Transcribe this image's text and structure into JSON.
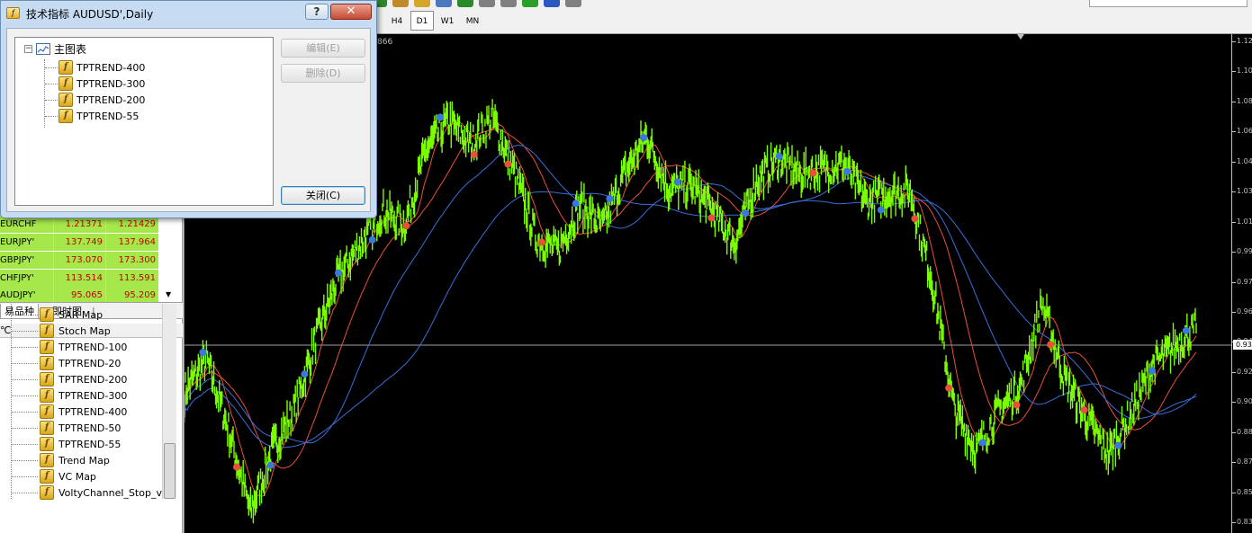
{
  "toolbar": {
    "timeframes": [
      "H4",
      "D1",
      "W1",
      "MN"
    ],
    "active_timeframe": "D1",
    "icon_colors": [
      "#2a8a2a",
      "#c08a2a",
      "#d6a62a",
      "#4a78c0",
      "#2a8a2a",
      "#808080",
      "#808080",
      "#2aa02a",
      "#2a58c0",
      "#808080"
    ]
  },
  "dialog": {
    "title": "技术指标 AUDUSD',Daily",
    "help_label": "?",
    "close_label": "✕",
    "tree_root": "主图表",
    "collapse_glyph": "−",
    "items": [
      {
        "label": "TPTREND-400",
        "icon": "indicator-icon"
      },
      {
        "label": "TPTREND-300",
        "icon": "indicator-icon"
      },
      {
        "label": "TPTREND-200",
        "icon": "indicator-icon"
      },
      {
        "label": "TPTREND-55",
        "icon": "indicator-icon"
      }
    ],
    "edit_button": "编辑(E)",
    "delete_button": "删除(D)",
    "close_button": "关闭(C)",
    "icon_glyph": "f"
  },
  "market_watch": {
    "rows": [
      {
        "symbol": "EURCHF",
        "bid": "1.21371",
        "ask": "1.21429"
      },
      {
        "symbol": "EURJPY'",
        "bid": "137.749",
        "ask": "137.964"
      },
      {
        "symbol": "GBPJPY'",
        "bid": "173.070",
        "ask": "173.300"
      },
      {
        "symbol": "CHFJPY'",
        "bid": "113.514",
        "ask": "113.591"
      },
      {
        "symbol": "AUDJPY'",
        "bid": "95.065",
        "ask": "95.209"
      }
    ],
    "tabs": [
      "易品种",
      "即时图"
    ],
    "scroll_glyph": "▼",
    "row_color": "#a6e84a",
    "price_color": "#c00000"
  },
  "navigator": {
    "title": "℃",
    "close_glyph": "✕",
    "items": [
      "SAR Map",
      "Stoch Map",
      "TPTREND-100",
      "TPTREND-20",
      "TPTREND-200",
      "TPTREND-300",
      "TPTREND-400",
      "TPTREND-50",
      "TPTREND-55",
      "Trend Map",
      "VC Map",
      "VoltyChannel_Stop_v."
    ]
  },
  "chart": {
    "corner_text": "866",
    "background": "#000000",
    "price_color": "#7cfc00",
    "price_ticks": [
      "1.12",
      "1.10",
      "1.08",
      "1.06",
      "1.04",
      "1.03",
      "1.01",
      "0.99",
      "0.97",
      "0.96",
      "0.94",
      "0.92",
      "0.90",
      "0.88",
      "0.87",
      "0.85",
      "0.83"
    ],
    "current_price_label": "0.93",
    "current_price": 0.934
  },
  "chart_data": {
    "type": "line",
    "series": [
      {
        "values": [
          0.909,
          0.928,
          0.886,
          0.836,
          0.874,
          0.898,
          0.942,
          0.978,
          0.998,
          1.018,
          1.009,
          1.055,
          1.072,
          1.058,
          1.074,
          1.041,
          1.001,
          0.994,
          1.022,
          1.008,
          1.04,
          1.063,
          1.031,
          1.033,
          1.018,
          0.998,
          1.036,
          1.049,
          1.04,
          1.043,
          1.046,
          1.023,
          1.028,
          1.03,
          0.975,
          0.898,
          0.873,
          0.897,
          0.912,
          0.962,
          0.917,
          0.893,
          0.871,
          0.895,
          0.924,
          0.936,
          0.947
        ]
      },
      {
        "values": [
          0.913,
          0.895,
          0.868,
          0.884,
          0.921,
          0.948,
          0.962,
          0.978,
          0.992,
          1.002,
          1.01,
          1.028,
          1.045,
          1.058,
          1.052,
          1.045,
          1.042,
          1.037,
          1.034,
          1.04,
          1.052,
          1.046,
          1.042,
          1.034,
          1.03,
          1.032,
          1.034,
          1.034,
          1.034,
          1.036,
          1.035,
          1.034,
          1.021,
          0.995,
          0.965,
          0.943,
          0.934,
          0.928,
          0.922,
          0.919,
          0.912,
          0.905
        ]
      }
    ]
  }
}
